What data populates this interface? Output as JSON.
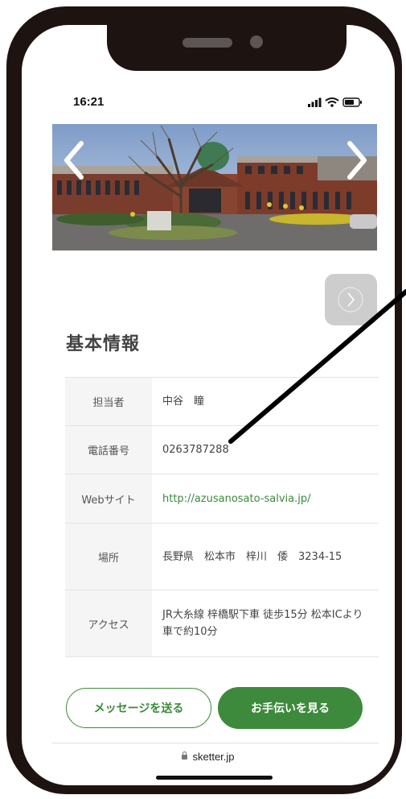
{
  "status_bar": {
    "time": "16:21"
  },
  "hero": {
    "prev_icon": "chevron-left-icon",
    "next_icon": "chevron-right-icon",
    "photo": "facility building photo"
  },
  "gallery": {
    "next_icon": "chevron-right-icon"
  },
  "section": {
    "title": "基本情報"
  },
  "info": {
    "rows": [
      {
        "label": "担当者",
        "value": "中谷　瞳"
      },
      {
        "label": "電話番号",
        "value": "0263787288"
      },
      {
        "label": "Webサイト",
        "value": "http://azusanosato-salvia.jp/"
      },
      {
        "label": "場所",
        "value": "長野県　松本市　梓川　倭　3234-15"
      },
      {
        "label": "アクセス",
        "value": "JR大糸線 梓橋駅下車 徒歩15分 松本ICより車で約10分"
      }
    ]
  },
  "actions": {
    "message_label": "メッセージを送る",
    "help_label": "お手伝いを見る"
  },
  "browser": {
    "url": "sketter.jp",
    "lock_icon": "lock-icon"
  },
  "colors": {
    "accent": "#3d8a3c",
    "frame": "#1d1311"
  }
}
